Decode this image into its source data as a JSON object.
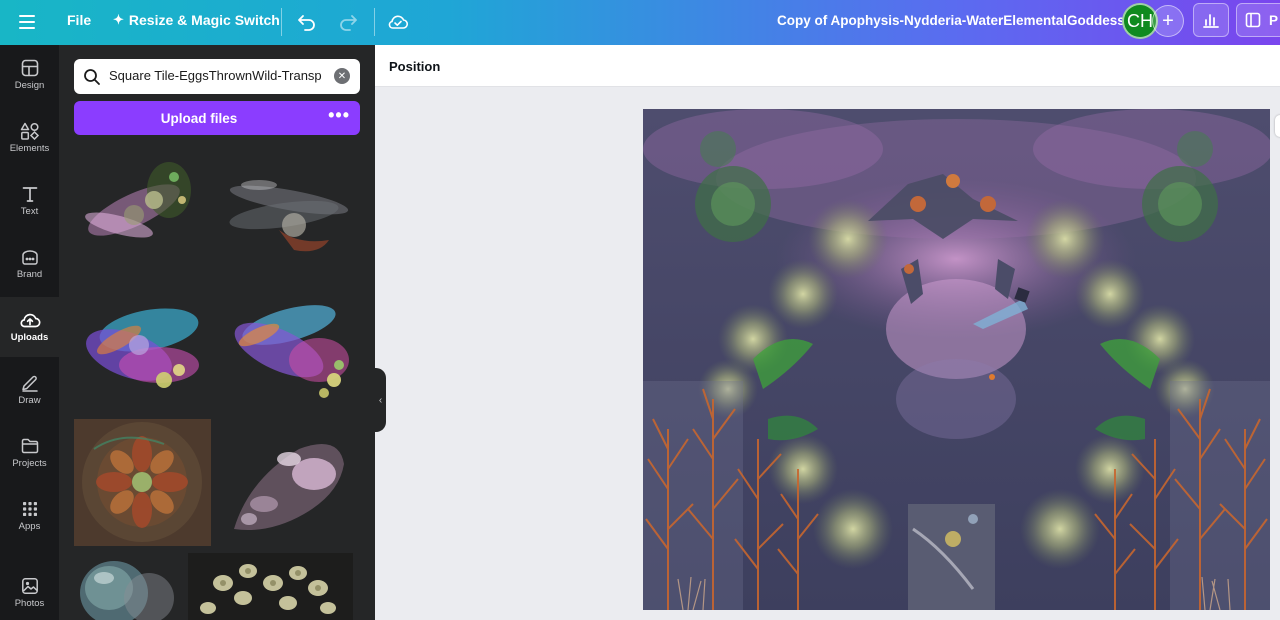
{
  "topbar": {
    "file_label": "File",
    "resize_label": "Resize & Magic Switch",
    "doc_title": "Copy of Apophysis-Nydderia-WaterElementalGoddess",
    "avatar_initials": "CH",
    "share_partial": "P"
  },
  "rail": {
    "items": [
      {
        "label": "Design",
        "icon": "design-icon"
      },
      {
        "label": "Elements",
        "icon": "elements-icon"
      },
      {
        "label": "Text",
        "icon": "text-icon"
      },
      {
        "label": "Brand",
        "icon": "brand-icon"
      },
      {
        "label": "Uploads",
        "icon": "uploads-icon",
        "active": true
      },
      {
        "label": "Draw",
        "icon": "draw-icon"
      },
      {
        "label": "Projects",
        "icon": "projects-icon"
      },
      {
        "label": "Apps",
        "icon": "apps-icon"
      },
      {
        "label": "Photos",
        "icon": "photos-icon"
      }
    ]
  },
  "panel": {
    "search_value": "Square Tile-EggsThrownWild-Transp",
    "upload_label": "Upload files"
  },
  "context": {
    "position_label": "Position"
  },
  "colors": {
    "accent": "#8b3dff",
    "avatar": "#0f8a1f",
    "rail_bg": "#18191b",
    "panel_bg": "#252627"
  }
}
